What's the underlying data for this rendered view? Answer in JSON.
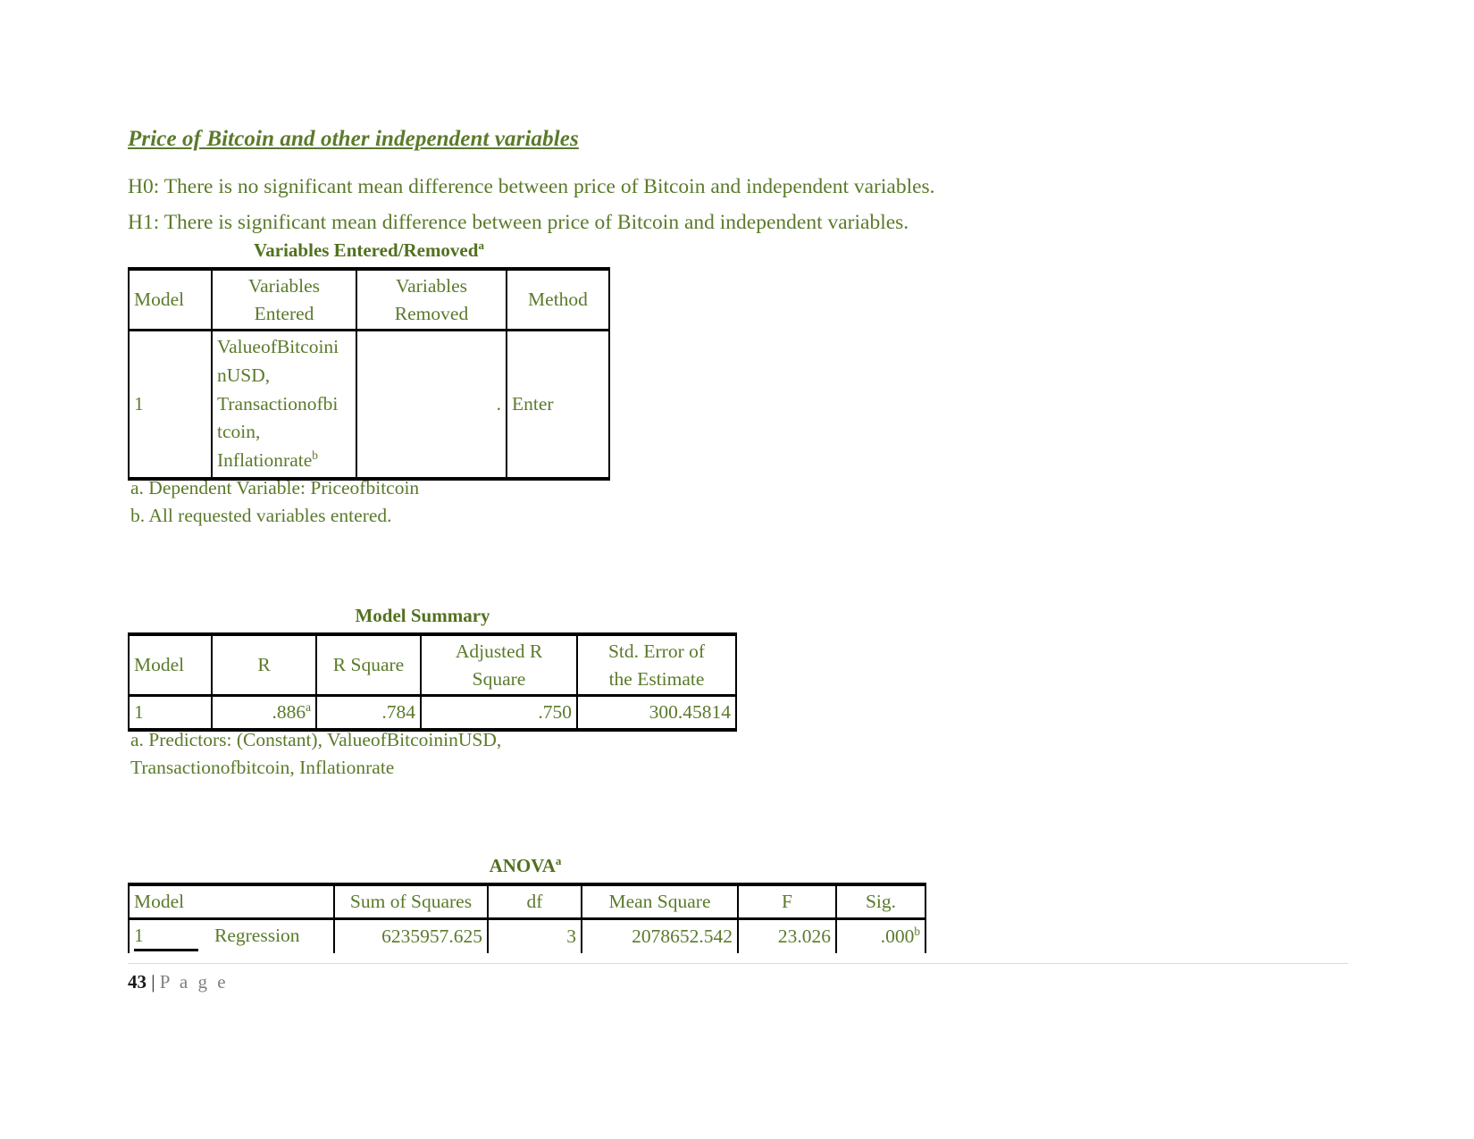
{
  "document": {
    "section_title": "Price of Bitcoin and other independent variables",
    "hypotheses": {
      "h0": "H0: There is no significant mean difference between price of Bitcoin and independent variables.",
      "h1": "H1: There is significant mean difference between price of Bitcoin and independent variables."
    },
    "footer": {
      "page_number": "43",
      "separator": "|",
      "label": "P a g e"
    },
    "theme": {
      "text_green": "#5b7a2b",
      "caption_green": "#52711f",
      "rule_black": "#000000",
      "footer_gray": "#808080"
    }
  },
  "tables": {
    "variables_entered_removed": {
      "caption": "Variables Entered/Removed",
      "caption_sup": "a",
      "headers": [
        "Model",
        "Variables Entered",
        "Variables Removed",
        "Method"
      ],
      "header_lines": {
        "col1": "Model",
        "col2_line1": "Variables",
        "col2_line2": "Entered",
        "col3_line1": "Variables",
        "col3_line2": "Removed",
        "col4": "Method"
      },
      "row": {
        "model": "1",
        "variables_entered_lines": [
          "ValueofBitcoini",
          "nUSD,",
          "Transactionofbi",
          "tcoin,",
          "Inflationrate"
        ],
        "variables_entered_sup": "b",
        "variables_removed": ".",
        "method": "Enter"
      },
      "notes": [
        "a. Dependent Variable: Priceofbitcoin",
        "b. All requested variables entered."
      ]
    },
    "model_summary": {
      "caption": "Model Summary",
      "headers": {
        "model": "Model",
        "r": "R",
        "r_square": "R Square",
        "adjusted_r_square_line1": "Adjusted R",
        "adjusted_r_square_line2": "Square",
        "std_error_line1": "Std. Error of",
        "std_error_line2": "the Estimate"
      },
      "row": {
        "model": "1",
        "r": ".886",
        "r_sup": "a",
        "r_square": ".784",
        "adjusted_r_square": ".750",
        "std_error_of_estimate": "300.45814"
      },
      "notes": [
        "a. Predictors: (Constant), ValueofBitcoininUSD,",
        "Transactionofbitcoin, Inflationrate"
      ]
    },
    "anova": {
      "caption": "ANOVA",
      "caption_sup": "a",
      "headers": [
        "Model",
        "Sum of Squares",
        "df",
        "Mean Square",
        "F",
        "Sig."
      ],
      "row": {
        "model": "1",
        "source": "Regression",
        "sum_of_squares": "6235957.625",
        "df": "3",
        "mean_square": "2078652.542",
        "f": "23.026",
        "sig": ".000",
        "sig_sup": "b"
      }
    }
  }
}
